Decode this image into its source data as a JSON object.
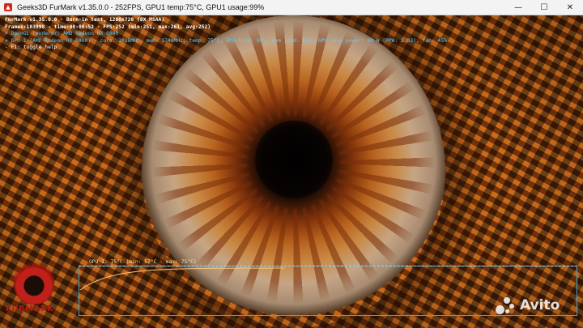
{
  "window": {
    "title": "Geeks3D FurMark v1.35.0.0 - 252FPS, GPU1 temp:75°C, GPU1 usage:99%",
    "minimize_glyph": "—",
    "maximize_glyph": "☐",
    "close_glyph": "✕",
    "icon": "furmark-app-icon"
  },
  "hud": {
    "line1": "FurMark v1.35.0.0 - Burn-in test, 1280x720 (8X MSAA)",
    "line2": "Frames:103998 - time:00:06:52 - FPS:252 (min:251, max:261, avg:252)",
    "line3": "> OpenGL renderer: AMD Radeon RX 6800",
    "line4": "> GPU 1 (AMD Radeon RX 6800) - core: 2016MHz, mem: 1740MHz, temp: 75°C, GPU load: 99%, mem load: 16%, GPU chip power: 89 W (PPW: 2.83), fan: 45%",
    "line5": "- F1: toggle help"
  },
  "temp_graph": {
    "label": "GPU 1: 75°C (min: 57°C - max: 75°C)",
    "line_color": "#f2c77a",
    "min_c": 57,
    "max_c": 75,
    "current_c": 75
  },
  "logo": {
    "text": "FURMARK",
    "icon": "furmark-flame-logo"
  },
  "watermark": {
    "text": "Avito",
    "icon": "avito-dots-icon"
  }
}
